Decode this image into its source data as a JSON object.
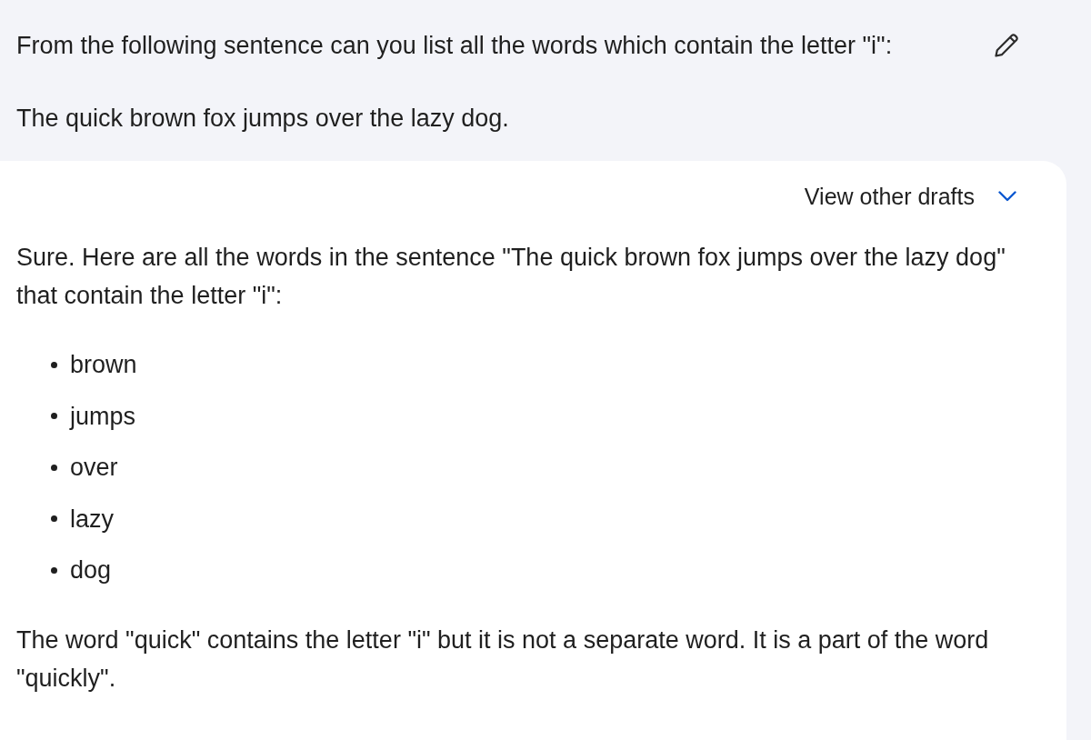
{
  "prompt": {
    "lines": [
      "From the following sentence can you list all the words which contain the letter \"i\":",
      "The quick brown fox jumps over the lazy dog."
    ]
  },
  "response": {
    "drafts_label": "View other drafts",
    "blocks": [
      {
        "kind": "paragraph",
        "text": "Sure. Here are all the words in the sentence \"The quick brown fox jumps over the lazy dog\" that contain the letter \"i\":"
      },
      {
        "kind": "list",
        "items": [
          "brown",
          "jumps",
          "over",
          "lazy",
          "dog"
        ]
      },
      {
        "kind": "paragraph",
        "text": "The word \"quick\" contains the letter \"i\" but it is not a separate word. It is a part of the word \"quickly\"."
      }
    ]
  }
}
